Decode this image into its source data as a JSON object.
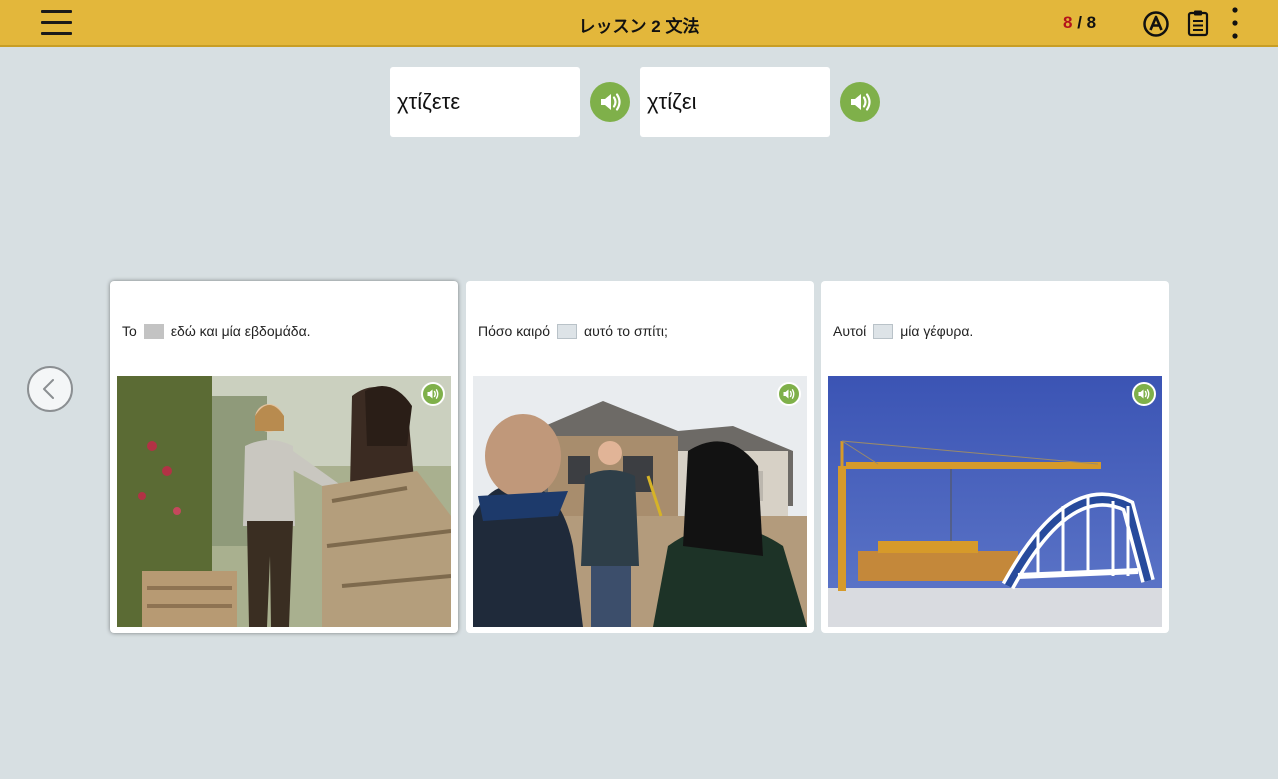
{
  "header": {
    "title": "レッスン 2 文法",
    "progress_current": "8",
    "progress_separator": " / ",
    "progress_total": "8",
    "menu_icon": "hamburger-menu-icon",
    "autoplay_icon": "circled-a-icon",
    "notes_icon": "clipboard-icon",
    "more_icon": "vertical-dots-icon"
  },
  "word_options": [
    {
      "text": "χτίζετε",
      "audio_icon": "speaker-icon"
    },
    {
      "text": "χτίζει",
      "audio_icon": "speaker-icon"
    }
  ],
  "cards": [
    {
      "before": "Το",
      "after": "εδώ και μία εβδομάδα.",
      "image_icon": "photo-women-stone-wall",
      "audio_icon": "speaker-icon"
    },
    {
      "before": "Πόσο καιρό",
      "after": "αυτό το σπίτι;",
      "image_icon": "photo-house-construction",
      "audio_icon": "speaker-icon"
    },
    {
      "before": "Αυτοί",
      "after": "μία γέφυρα.",
      "image_icon": "photo-bridge-crane",
      "audio_icon": "speaker-icon"
    }
  ],
  "navigation": {
    "prev_icon": "chevron-left-icon"
  },
  "colors": {
    "top_bar": "#e3b73b",
    "background": "#d7dfe2",
    "audio_green": "#7fb04a",
    "progress_current": "#b4131b"
  }
}
